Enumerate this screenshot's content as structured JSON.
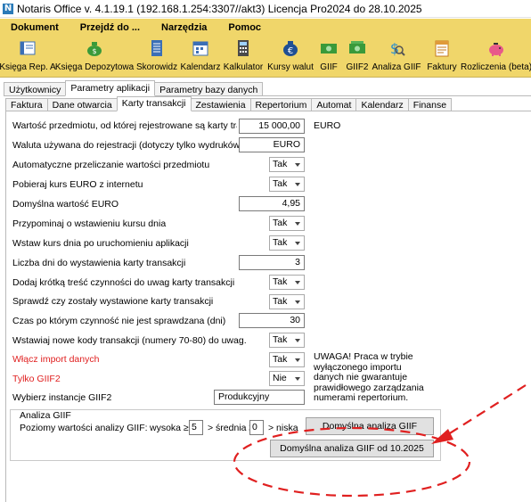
{
  "window": {
    "title": "Notaris Office v. 4.1.19.1 (192.168.1.254:3307//akt3) Licencja Pro2024 do 28.10.2025"
  },
  "menu": [
    "Dokument",
    "Przejdź do ...",
    "Narzędzia",
    "Pomoc"
  ],
  "toolbar": [
    {
      "label": "Księga Rep. A",
      "icon": "book-icon"
    },
    {
      "label": "Księga Depozytowa",
      "icon": "money-bag-icon"
    },
    {
      "label": "Skorowidz",
      "icon": "index-icon"
    },
    {
      "label": "Kalendarz",
      "icon": "calendar-icon"
    },
    {
      "label": "Kalkulator",
      "icon": "calculator-icon"
    },
    {
      "label": "Kursy walut",
      "icon": "euro-icon"
    },
    {
      "label": "GIIF",
      "icon": "money-icon"
    },
    {
      "label": "GIIF2",
      "icon": "money2-icon"
    },
    {
      "label": "Analiza GIIF",
      "icon": "analysis-icon"
    },
    {
      "label": "Faktury",
      "icon": "invoice-icon"
    },
    {
      "label": "Rozliczenia (beta)",
      "icon": "piggy-bank-icon"
    }
  ],
  "outer_tabs": [
    "Użytkownicy",
    "Parametry aplikacji",
    "Parametry bazy danych"
  ],
  "inner_tabs": [
    "Faktura",
    "Dane otwarcia",
    "Karty transakcji",
    "Zestawienia",
    "Repertorium",
    "Automat",
    "Kalendarz",
    "Finanse"
  ],
  "form": {
    "threshold_label": "Wartość przedmiotu, od której rejestrowane są karty transakcji",
    "threshold_value": "15 000,00",
    "threshold_unit": "EURO",
    "currency_label": "Waluta używana do rejestracji (dotyczy tylko wydruków)",
    "currency_value": "EURO",
    "auto_convert_label": "Automatyczne przeliczanie wartości przedmiotu",
    "auto_convert_value": "Tak",
    "fetch_rate_label": "Pobieraj kurs EURO z internetu",
    "fetch_rate_value": "Tak",
    "default_euro_label": "Domyślna wartość EURO",
    "default_euro_value": "4,95",
    "remind_rate_label": "Przypominaj o wstawieniu kursu dnia",
    "remind_rate_value": "Tak",
    "insert_rate_label": "Wstaw kurs dnia po uruchomieniu aplikacji",
    "insert_rate_value": "Tak",
    "days_label": "Liczba dni do wystawienia karty transakcji",
    "days_value": "3",
    "add_content_label": "Dodaj krótką treść czynności do uwag karty transakcji",
    "add_content_value": "Tak",
    "check_label": "Sprawdź czy zostały wystawione karty transakcji",
    "check_value": "Tak",
    "time_label": "Czas po którym czynność nie jest sprawdzana (dni)",
    "time_value": "30",
    "codes_label": "Wstawiaj nowe kody transakcji (numery 70-80) do uwag.",
    "codes_value": "Tak",
    "import_label": "Włącz import danych",
    "import_value": "Tak",
    "giif2_only_label": "Tylko GIIF2",
    "giif2_only_value": "Nie",
    "instances_label": "Wybierz instancje GIIF2",
    "instances_value": "Produkcyjny",
    "warning": "UWAGA! Praca w trybie wyłączonego importu danych nie gwarantuje prawidłowego zarządzania numerami repertorium."
  },
  "analysis": {
    "group_title": "Analiza GIIF",
    "levels_label": "Poziomy wartości analizy GIIF:",
    "high_label": "wysoka ≥",
    "high_value": "5",
    "mid_label": "> średnia ≥",
    "mid_value": "0",
    "low_label": "> niska",
    "default_button": "Domyślna analiza GIIF",
    "default_2025_button": "Domyślna analiza GIIF od 10.2025"
  },
  "colors": {
    "toolbar_bg": "#f0d66a",
    "annotation_red": "#e02020"
  }
}
